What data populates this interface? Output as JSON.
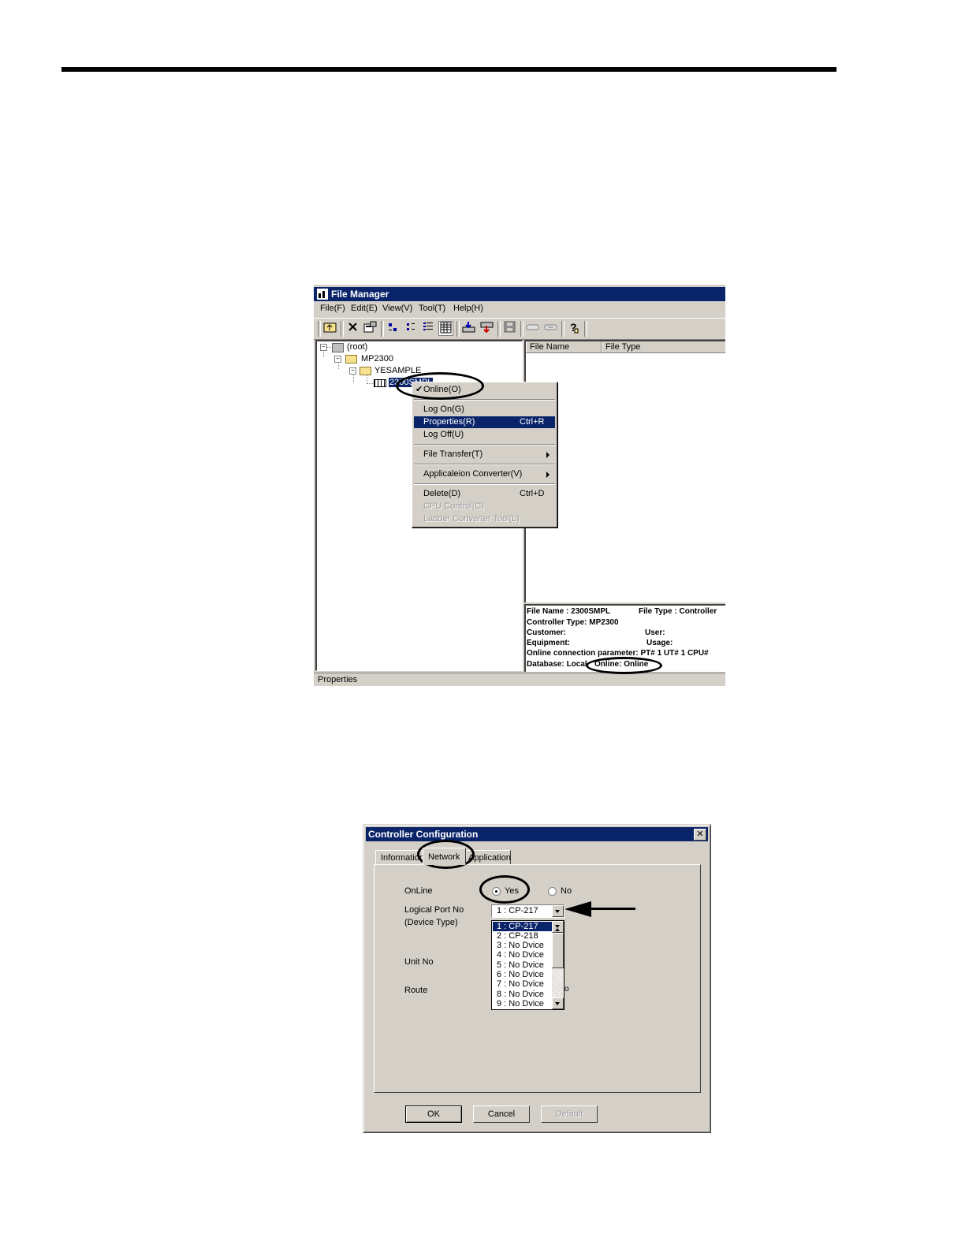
{
  "file_manager": {
    "title": "File Manager",
    "menu": [
      "File(F)",
      "Edit(E)",
      "View(V)",
      "Tool(T)",
      "Help(H)"
    ],
    "toolbar": {
      "up": "up-folder-icon",
      "delete": "delete-x-icon",
      "properties": "properties-icon",
      "large_icons": "large-icons-view-icon",
      "small_icons": "small-icons-view-icon",
      "list": "list-view-icon",
      "details": "details-view-icon",
      "transfer_in": "transfer-in-icon",
      "transfer_out": "transfer-out-icon",
      "save": "save-icon",
      "link1": "link-icon",
      "link2": "unlink-icon",
      "help": "help-icon"
    },
    "tree": {
      "root": "(root)",
      "folder1": "MP2300",
      "folder2": "YESAMPLE",
      "controller": "2300SMPL"
    },
    "columns": [
      "File Name",
      "File Type"
    ],
    "context_menu": {
      "online": "Online(O)",
      "log_on": "Log On(G)",
      "properties": "Properties(R)",
      "properties_shortcut": "Ctrl+R",
      "log_off": "Log Off(U)",
      "file_transfer": "File Transfer(T)",
      "app_converter": "Applicaleion Converter(V)",
      "delete": "Delete(D)",
      "delete_shortcut": "Ctrl+D",
      "cpu_control": "CPU Control(C)",
      "ladder_converter": "Ladder Converter Tool(L)"
    },
    "info": {
      "file_name": "File Name : 2300SMPL",
      "file_type": "File Type : Controller",
      "controller_type": "Controller Type: MP2300",
      "customer": "Customer:",
      "user": "User:",
      "equipment": "Equipment:",
      "usage": "Usage:",
      "online_param": "Online connection parameter: PT# 1 UT# 1 CPU#",
      "database": "Database: Local",
      "online": "Online: Online"
    },
    "status": "Properties"
  },
  "controller_config": {
    "title": "Controller Configuration",
    "tabs": [
      "Information",
      "Network",
      "Application"
    ],
    "online_label": "OnLine",
    "yes_label": "Yes",
    "no_label": "No",
    "logical_port_label": "Logical Port No",
    "device_type_label": "(Device Type)",
    "unit_no_label": "Unit No",
    "route_label": "Route",
    "route_fragment": "o",
    "selected_port": "1 : CP-217",
    "port_options": [
      "1 : CP-217",
      "2 : CP-218",
      "3 : No Dvice",
      "4 : No Dvice",
      "5 : No Dvice",
      "6 : No Dvice",
      "7 : No Dvice",
      "8 : No Dvice",
      "9 : No Dvice"
    ],
    "buttons": {
      "ok": "OK",
      "cancel": "Cancel",
      "default": "Default"
    }
  }
}
